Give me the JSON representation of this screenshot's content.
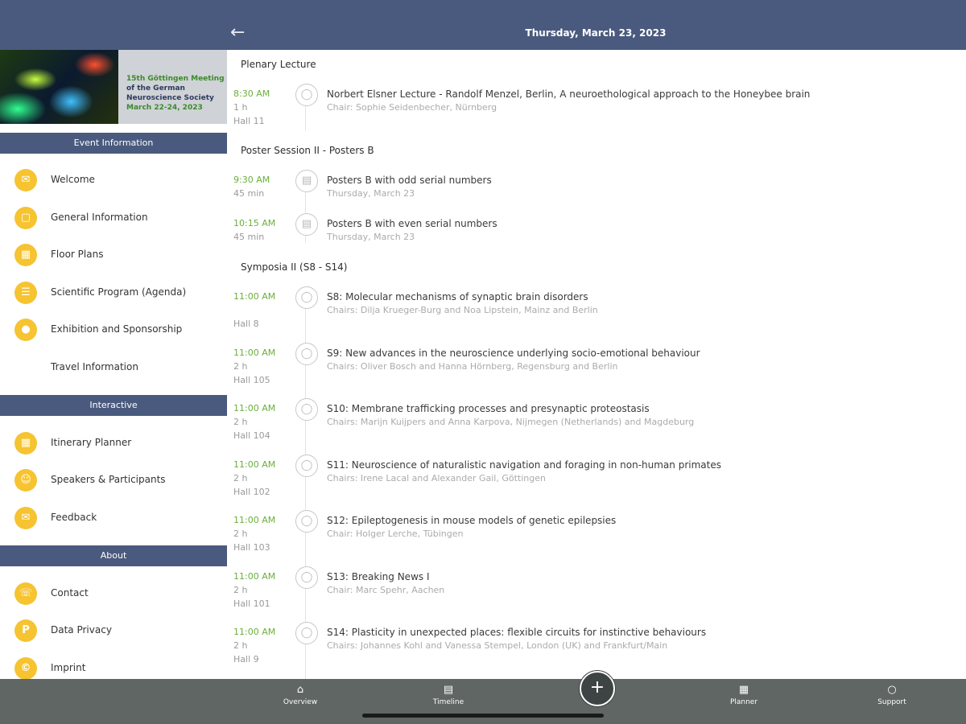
{
  "header": {
    "date_title": "Thursday, March 23, 2023"
  },
  "banner": {
    "line1": "15th Göttingen Meeting",
    "line2": "of the German",
    "line3": "Neuroscience Society",
    "line4": "March 22-24, 2023"
  },
  "sidebar": {
    "sections": [
      {
        "title": "Event Information",
        "items": [
          {
            "label": "Welcome",
            "icon": "welcome-icon"
          },
          {
            "label": "General Information",
            "icon": "folder-icon"
          },
          {
            "label": "Floor Plans",
            "icon": "map-icon"
          },
          {
            "label": "Scientific Program (Agenda)",
            "icon": "agenda-icon"
          },
          {
            "label": "Exhibition and Sponsorship",
            "icon": "location-pin-icon"
          },
          {
            "label": "Travel Information",
            "icon": ""
          }
        ]
      },
      {
        "title": "Interactive",
        "items": [
          {
            "label": "Itinerary Planner",
            "icon": "calendar-grid-icon"
          },
          {
            "label": "Speakers & Participants",
            "icon": "people-icon"
          },
          {
            "label": "Feedback",
            "icon": "chat-icon"
          }
        ]
      },
      {
        "title": "About",
        "items": [
          {
            "label": "Contact",
            "icon": "contact-icon"
          },
          {
            "label": "Data Privacy",
            "icon": "privacy-icon"
          },
          {
            "label": "Imprint",
            "icon": "imprint-icon"
          }
        ]
      }
    ]
  },
  "agenda": [
    {
      "section": "Plenary Lecture",
      "sessions": [
        {
          "time": "8:30 AM",
          "duration": "1 h",
          "hall": "Hall 11",
          "title": "Norbert Elsner Lecture - Randolf Menzel, Berlin, A neuroethological approach to the Honeybee brain",
          "subtitle": "Chair: Sophie Seidenbecher, Nürnberg",
          "icon": "lightbulb-icon"
        }
      ]
    },
    {
      "section": "Poster Session II - Posters B",
      "sessions": [
        {
          "time": "9:30 AM",
          "duration": "45 min",
          "hall": "",
          "title": "Posters B with odd serial numbers",
          "subtitle": "Thursday, March 23",
          "icon": "poster-icon"
        },
        {
          "time": "10:15 AM",
          "duration": "45 min",
          "hall": "",
          "title": "Posters B with even serial numbers",
          "subtitle": "Thursday, March 23",
          "icon": "poster-icon"
        }
      ]
    },
    {
      "section": "Symposia II (S8 - S14)",
      "sessions": [
        {
          "time": "11:00 AM",
          "duration": "",
          "hall": "Hall 8",
          "title": "S8: Molecular mechanisms of synaptic brain disorders",
          "subtitle": "Chairs: Dilja Krueger-Burg and Noa Lipstein, Mainz and Berlin",
          "icon": "lightbulb-icon"
        },
        {
          "time": "11:00 AM",
          "duration": "2 h",
          "hall": "Hall 105",
          "title": "S9: New advances in the neuroscience underlying socio-emotional behaviour",
          "subtitle": "Chairs: Oliver Bosch and Hanna Hörnberg, Regensburg and Berlin",
          "icon": "lightbulb-icon"
        },
        {
          "time": "11:00 AM",
          "duration": "2 h",
          "hall": "Hall 104",
          "title": "S10: Membrane trafficking processes and presynaptic proteostasis",
          "subtitle": "Chairs: Marijn Kuijpers and Anna Karpova, Nijmegen (Netherlands) and Magdeburg",
          "icon": "lightbulb-icon"
        },
        {
          "time": "11:00 AM",
          "duration": "2 h",
          "hall": "Hall 102",
          "title": "S11: Neuroscience of naturalistic navigation and foraging in non-human primates",
          "subtitle": "Chairs: Irene Lacal and Alexander Gail, Göttingen",
          "icon": "lightbulb-icon"
        },
        {
          "time": "11:00 AM",
          "duration": "2 h",
          "hall": "Hall 103",
          "title": "S12: Epileptogenesis in mouse models of genetic epilepsies",
          "subtitle": "Chair: Holger Lerche, Tübingen",
          "icon": "lightbulb-icon"
        },
        {
          "time": "11:00 AM",
          "duration": "2 h",
          "hall": "Hall 101",
          "title": "S13: Breaking News I",
          "subtitle": "Chair: Marc Spehr, Aachen",
          "icon": "lightbulb-icon"
        },
        {
          "time": "11:00 AM",
          "duration": "2 h",
          "hall": "Hall 9",
          "title": "S14: Plasticity in unexpected places: flexible circuits for instinctive behaviours",
          "subtitle": "Chairs: Johannes Kohl and Vanessa Stempel, London (UK) and Frankfurt/Main",
          "icon": "lightbulb-icon"
        }
      ]
    }
  ],
  "bottom_tabs": [
    {
      "label": "Overview",
      "icon": "home-icon"
    },
    {
      "label": "Timeline",
      "icon": "timeline-icon"
    },
    {
      "label": "Planner",
      "icon": "calendar-icon"
    },
    {
      "label": "Support",
      "icon": "support-icon"
    }
  ]
}
